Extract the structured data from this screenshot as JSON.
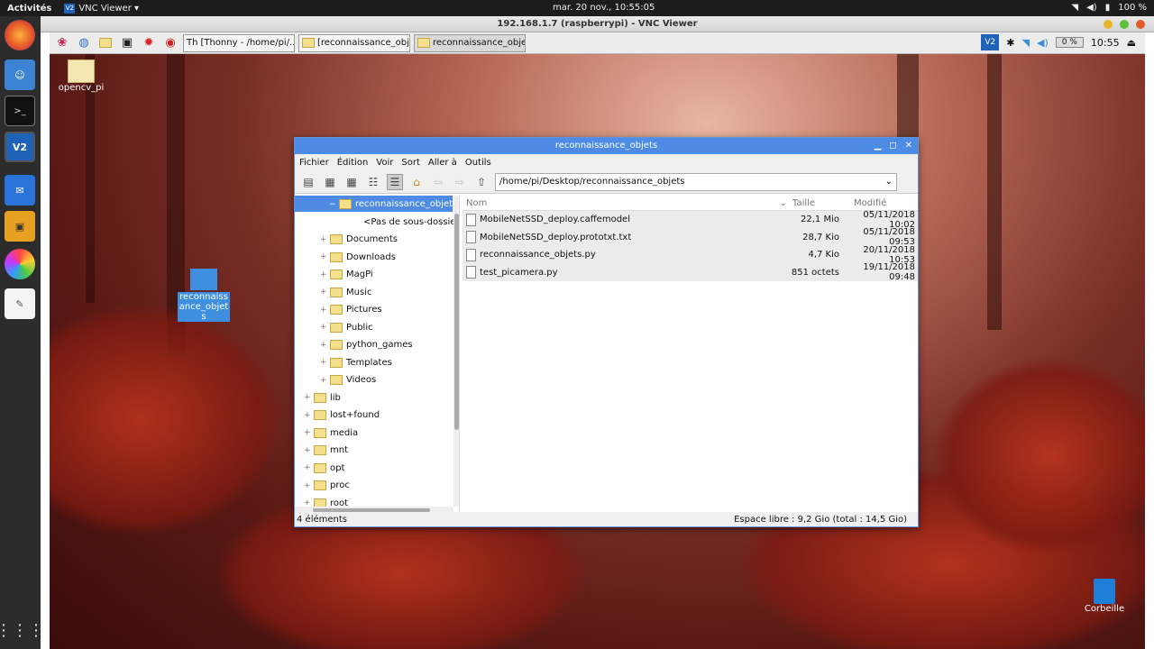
{
  "topbar": {
    "activities": "Activités",
    "app": "VNC Viewer ▾",
    "clock": "mar. 20 nov., 10:55:05",
    "battery": "100 %"
  },
  "vnc": {
    "title": "192.168.1.7 (raspberrypi) - VNC Viewer"
  },
  "panel": {
    "tasks": [
      {
        "label": "[Thonny - /home/pi/..."
      },
      {
        "label": "[reconnaissance_obje..."
      },
      {
        "label": "reconnaissance_objets"
      }
    ],
    "cpu": "0 %",
    "time": "10:55"
  },
  "desktop": {
    "icons": [
      {
        "label": "opencv_pi"
      },
      {
        "label": "reconnaissance_objets"
      }
    ],
    "trash": "Corbeille"
  },
  "fm": {
    "title": "reconnaissance_objets",
    "menu": [
      "Fichier",
      "Édition",
      "Voir",
      "Sort",
      "Aller à",
      "Outils"
    ],
    "path": "/home/pi/Desktop/reconnaissance_objets",
    "tree": {
      "selected": "reconnaissance_objets",
      "no_sub": "<Pas de sous-dossier>",
      "home_children": [
        "Documents",
        "Downloads",
        "MagPi",
        "Music",
        "Pictures",
        "Public",
        "python_games",
        "Templates",
        "Videos"
      ],
      "root_children": [
        "lib",
        "lost+found",
        "media",
        "mnt",
        "opt",
        "proc",
        "root"
      ]
    },
    "columns": {
      "name": "Nom",
      "size": "Taille",
      "modified": "Modifié"
    },
    "files": [
      {
        "name": "MobileNetSSD_deploy.caffemodel",
        "size": "22,1 Mio",
        "modified": "05/11/2018 10:02"
      },
      {
        "name": "MobileNetSSD_deploy.prototxt.txt",
        "size": "28,7 Kio",
        "modified": "05/11/2018 09:53"
      },
      {
        "name": "reconnaissance_objets.py",
        "size": "4,7 Kio",
        "modified": "20/11/2018 10:53"
      },
      {
        "name": "test_picamera.py",
        "size": "851 octets",
        "modified": "19/11/2018 09:48"
      }
    ],
    "status_left": "4 éléments",
    "status_right": "Espace libre : 9,2 Gio (total : 14,5 Gio)"
  }
}
